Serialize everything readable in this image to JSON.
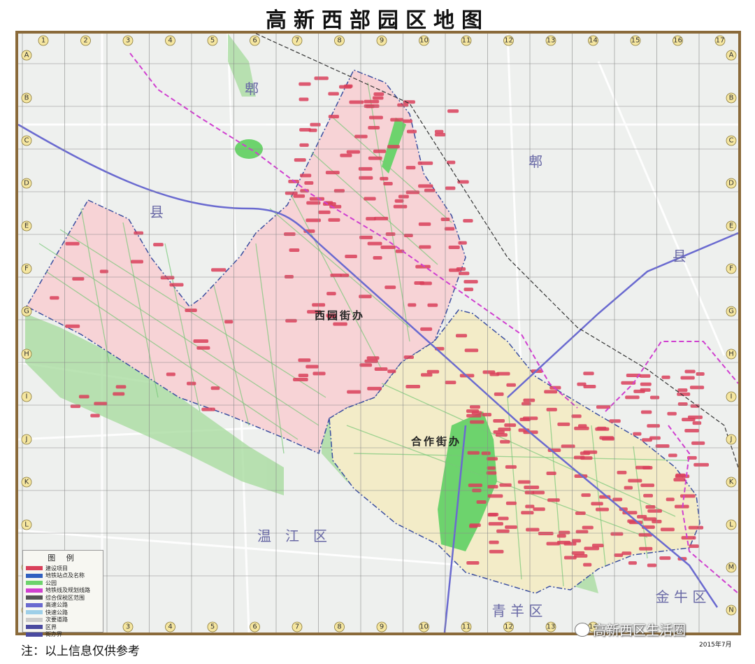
{
  "title": "高新西部园区地图",
  "columns": [
    "1",
    "2",
    "3",
    "4",
    "5",
    "6",
    "7",
    "8",
    "9",
    "10",
    "11",
    "12",
    "13",
    "14",
    "15",
    "16",
    "17"
  ],
  "rows": [
    "A",
    "B",
    "C",
    "D",
    "E",
    "F",
    "G",
    "H",
    "I",
    "J",
    "K",
    "L",
    "M",
    "N"
  ],
  "bottom_columns": [
    "3",
    "4",
    "5",
    "6",
    "7",
    "8",
    "9",
    "10",
    "11",
    "12",
    "13",
    "14"
  ],
  "area_labels": {
    "pi_1": "郫",
    "pi_2": "郫",
    "xian_1": "县",
    "xian_2": "县",
    "wenjiang": "温　江　区",
    "qingyang": "青 羊 区",
    "jinniu": "金 牛 区"
  },
  "subdistricts": {
    "xiyuan": "西园街办",
    "hezuo": "合作街办"
  },
  "legend": {
    "title": "图 例",
    "items": [
      {
        "label": "建设项目",
        "color": "#d9405a"
      },
      {
        "label": "地铁站点及名称",
        "color": "#3060c0"
      },
      {
        "label": "公园",
        "color": "#6dd36d"
      },
      {
        "label": "地铁线及规划线路",
        "color": "#d040d0"
      },
      {
        "label": "综合保税区范围",
        "color": "#555555"
      },
      {
        "label": "高速公路",
        "color": "#6a6ad0"
      },
      {
        "label": "快速公路",
        "color": "#9ecfe8"
      },
      {
        "label": "次要道路",
        "color": "#cccccc"
      },
      {
        "label": "区界",
        "color": "#4a4aa0"
      },
      {
        "label": "街办界",
        "color": "#4a4aa0"
      }
    ]
  },
  "note": "注：以上信息仅供参考",
  "date": "2015年7月",
  "watermark": "高新西区生活圈",
  "colors": {
    "frame": "#8a6a3a",
    "xiyuan_fill": "#f7d3d6",
    "hezuo_fill": "#f3ecc8",
    "park": "#6dd36d",
    "project": "#d9405a",
    "metro": "#d040d0",
    "expressway": "#6a6ad0"
  }
}
